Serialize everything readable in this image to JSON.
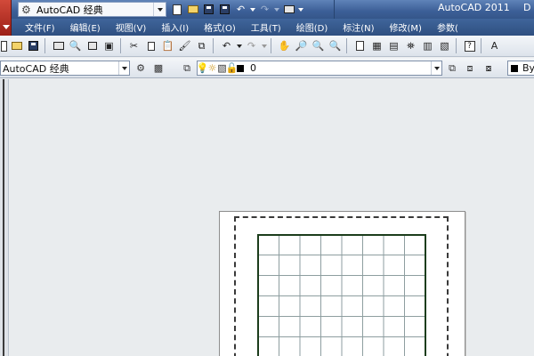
{
  "titlebar": {
    "workspace_combo": "AutoCAD 经典",
    "app_title": "AutoCAD 2011",
    "title_extra": "D"
  },
  "menubar": {
    "items": [
      "文件(F)",
      "编辑(E)",
      "视图(V)",
      "插入(I)",
      "格式(O)",
      "工具(T)",
      "绘图(D)",
      "标注(N)",
      "修改(M)",
      "参数("
    ]
  },
  "toolbar2": {
    "workspace_combo": "AutoCAD 经典",
    "layer_combo": "0",
    "color_combo": "By"
  },
  "colors": {
    "titlebar": "#3c5f97",
    "menubar": "#2f4f80",
    "app_button": "#c0392b",
    "canvas": "#e9ecee"
  }
}
